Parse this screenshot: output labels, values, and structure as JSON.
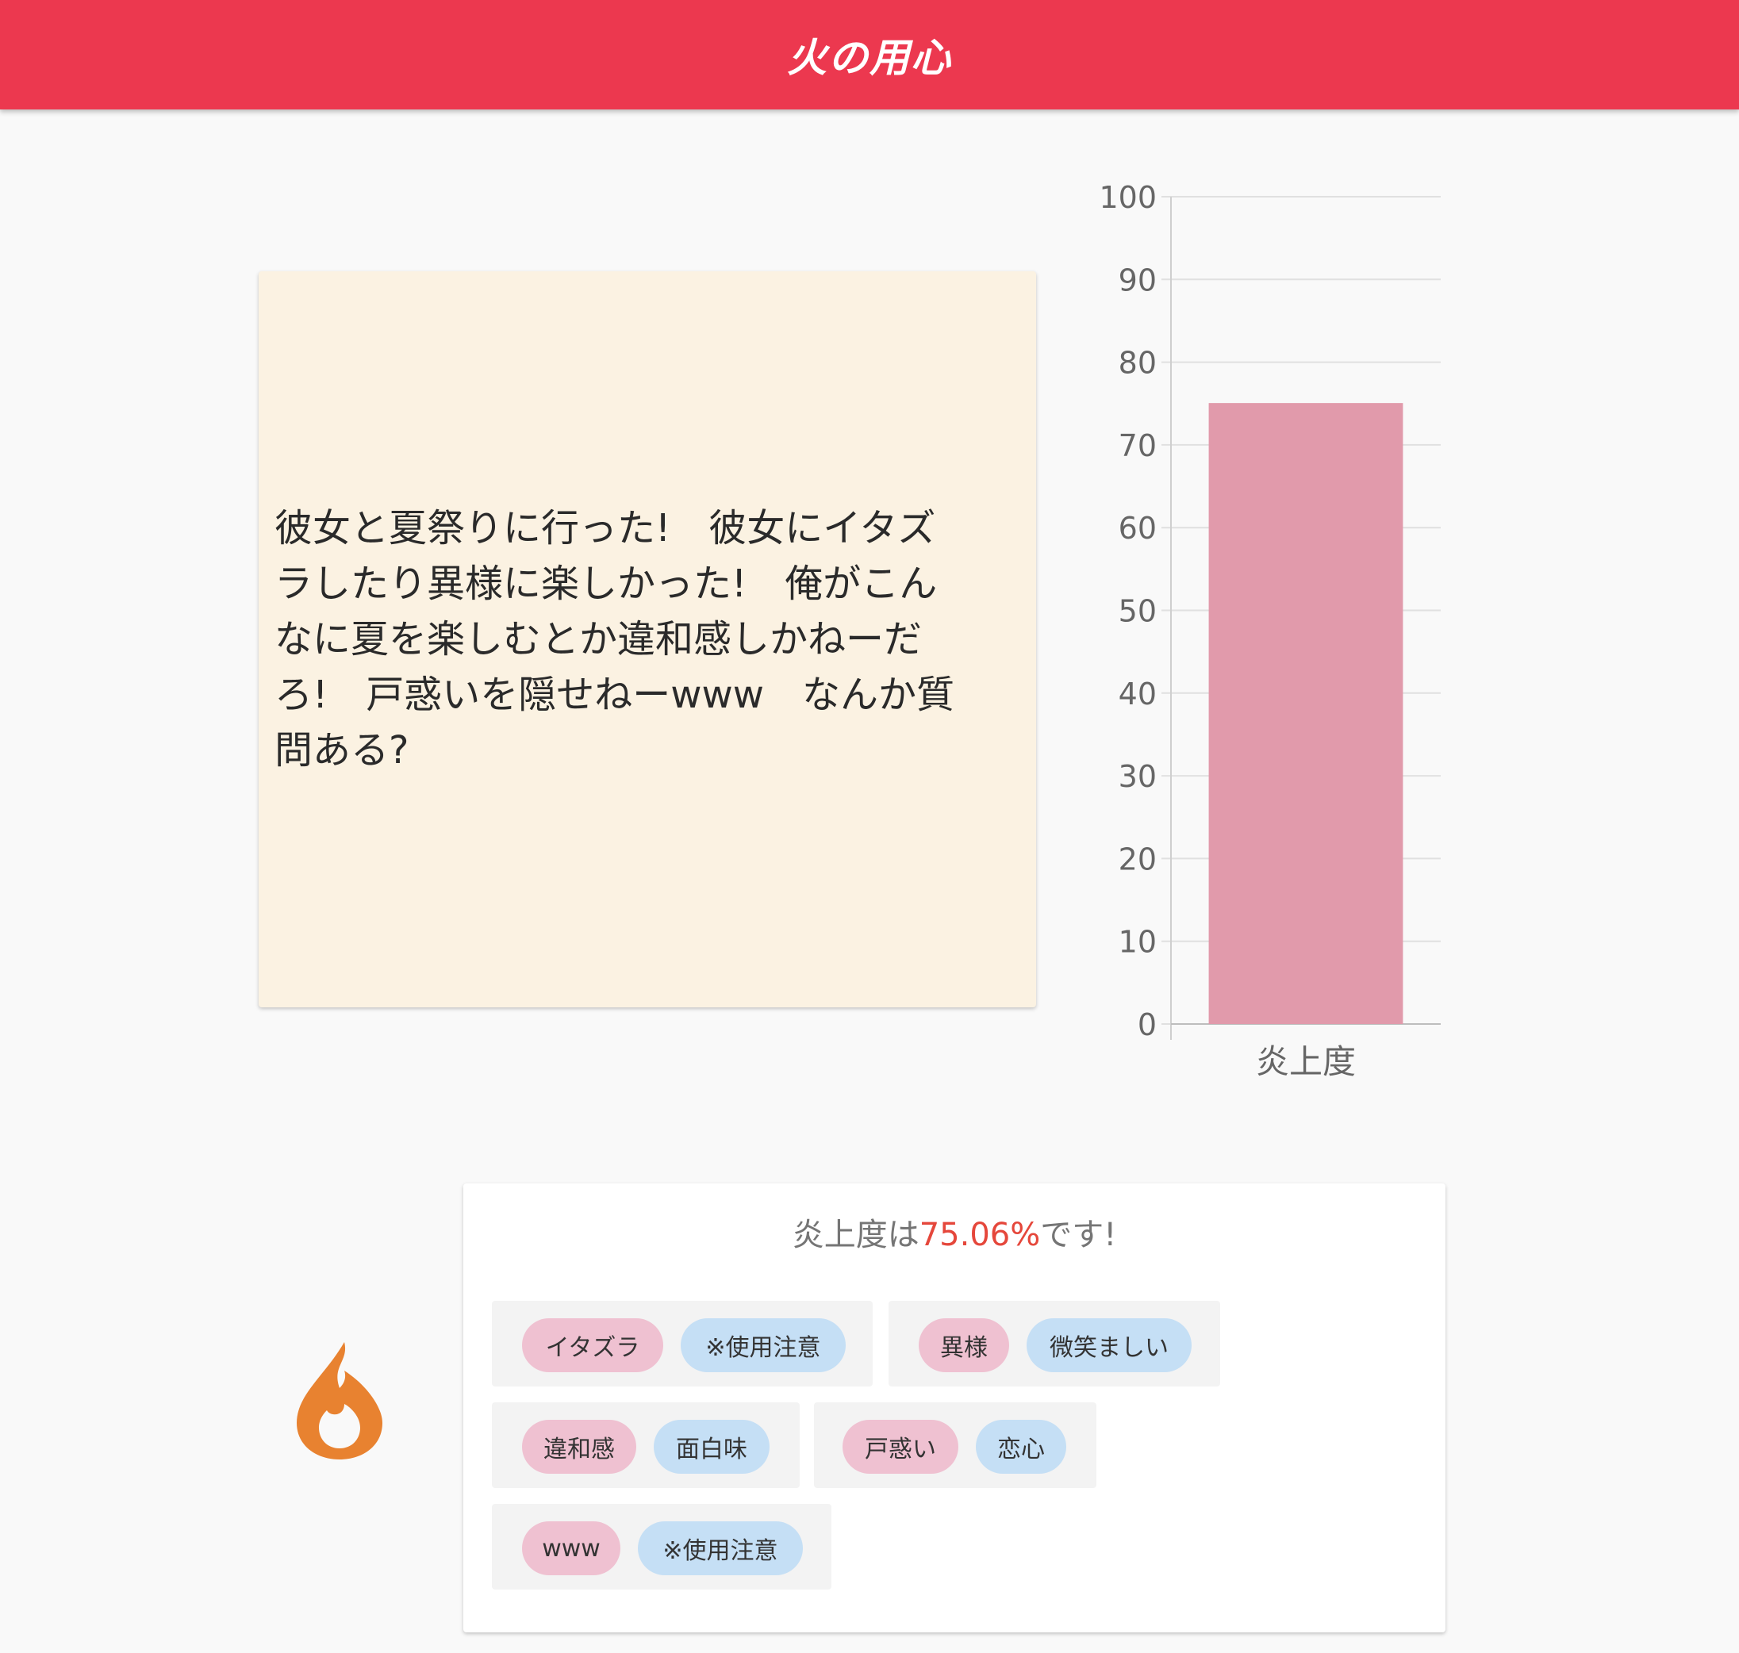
{
  "header": {
    "title": "火の用心"
  },
  "post": {
    "text": "彼女と夏祭りに行った!　彼女にイタズ\nラしたり異様に楽しかった!　俺がこん\nなに夏を楽しむとか違和感しかねーだ\nろ!　戸惑いを隠せねーwww　なんか質\n問ある?"
  },
  "chart_data": {
    "type": "bar",
    "categories": [
      "炎上度"
    ],
    "values": [
      75.06
    ],
    "ylim": [
      0,
      100
    ],
    "yticks": [
      0,
      10,
      20,
      30,
      40,
      50,
      60,
      70,
      80,
      90,
      100
    ],
    "grid": true,
    "bar_color": "#e19aab"
  },
  "result": {
    "prefix": "炎上度は",
    "value": "75.06%",
    "suffix": "です!",
    "value_color": "#e5473b"
  },
  "tag_groups": [
    {
      "word": "イタズラ",
      "label": "※使用注意"
    },
    {
      "word": "異様",
      "label": "微笑ましい"
    },
    {
      "word": "違和感",
      "label": "面白味"
    },
    {
      "word": "戸惑い",
      "label": "恋心"
    },
    {
      "word": "www",
      "label": "※使用注意"
    }
  ],
  "icons": {
    "flame": "flame-icon",
    "flame_color": "#e88230"
  }
}
